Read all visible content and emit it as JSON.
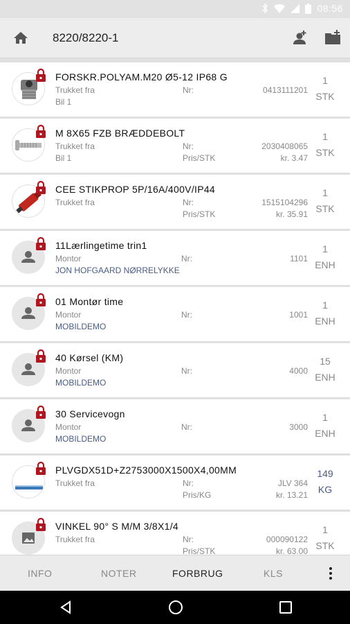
{
  "status_bar": {
    "time": "08:56"
  },
  "app_bar": {
    "title": "8220/8220-1"
  },
  "rows": [
    {
      "title": "FORSKR.POLYAM.M20 Ø5-12 IP68 G",
      "sub1": "Trukket fra",
      "sub2": "Bil 1",
      "label1": "Nr:",
      "value1": "0413111201",
      "label2": "",
      "value2": "",
      "qty": "1",
      "unit": "STK",
      "thumb": "cable-gland-image",
      "sub2_blue": false,
      "qty_blue": false
    },
    {
      "title": "M 8X65 FZB BRÆDDEBOLT",
      "sub1": "Trukket fra",
      "sub2": "Bil 1",
      "label1": "Nr:",
      "value1": "2030408065",
      "label2": "Pris/STK",
      "value2": "kr. 3.47",
      "qty": "1",
      "unit": "STK",
      "thumb": "bolt-image",
      "sub2_blue": false,
      "qty_blue": false
    },
    {
      "title": "CEE STIKPROP 5P/16A/400V/IP44",
      "sub1": "Trukket fra",
      "sub2": "",
      "label1": "Nr:",
      "value1": "1515104296",
      "label2": "Pris/STK",
      "value2": "kr. 35.91",
      "qty": "1",
      "unit": "STK",
      "thumb": "cee-plug-image",
      "sub2_blue": false,
      "qty_blue": false
    },
    {
      "title": "11Lærlingetime trin1",
      "sub1": "Montor",
      "sub2": "JON HOFGAARD NØRRELYKKE",
      "label1": "Nr:",
      "value1": "1101",
      "label2": "",
      "value2": "",
      "qty": "1",
      "unit": "ENH",
      "thumb": "person-icon",
      "sub2_blue": true,
      "qty_blue": false
    },
    {
      "title": "01 Montør time",
      "sub1": "Montor",
      "sub2": "MOBILDEMO",
      "label1": "Nr:",
      "value1": "1001",
      "label2": "",
      "value2": "",
      "qty": "1",
      "unit": "ENH",
      "thumb": "person-icon",
      "sub2_blue": true,
      "qty_blue": false
    },
    {
      "title": "40 Kørsel (KM)",
      "sub1": "Montor",
      "sub2": "MOBILDEMO",
      "label1": "Nr:",
      "value1": "4000",
      "label2": "",
      "value2": "",
      "qty": "15",
      "unit": "ENH",
      "thumb": "person-icon",
      "sub2_blue": true,
      "qty_blue": false
    },
    {
      "title": "30 Servicevogn",
      "sub1": "Montor",
      "sub2": "MOBILDEMO",
      "label1": "Nr:",
      "value1": "3000",
      "label2": "",
      "value2": "",
      "qty": "1",
      "unit": "ENH",
      "thumb": "person-icon",
      "sub2_blue": true,
      "qty_blue": false
    },
    {
      "title": "PLVGDX51D+Z2753000X1500X4,00MM",
      "sub1": "Trukket fra",
      "sub2": "",
      "label1": "Nr:",
      "value1": "JLV 364",
      "label2": "Pris/KG",
      "value2": "kr. 13.21",
      "qty": "149",
      "unit": "KG",
      "thumb": "plate-image",
      "sub2_blue": false,
      "qty_blue": true
    },
    {
      "title": "VINKEL 90° S M/M 3/8X1/4",
      "sub1": "Trukket fra",
      "sub2": "",
      "label1": "Nr:",
      "value1": "000090122",
      "label2": "Pris/STK",
      "value2": "kr. 63.00",
      "qty": "1",
      "unit": "STK",
      "thumb": "image-placeholder-icon",
      "sub2_blue": false,
      "qty_blue": false
    }
  ],
  "tabs": [
    {
      "label": "INFO",
      "active": false
    },
    {
      "label": "NOTER",
      "active": false
    },
    {
      "label": "FORBRUG",
      "active": true
    },
    {
      "label": "KLS",
      "active": false
    }
  ],
  "colors": {
    "lock_red": "#b0161f",
    "accent_blue": "#4a5c86",
    "text_gray": "#888888"
  }
}
